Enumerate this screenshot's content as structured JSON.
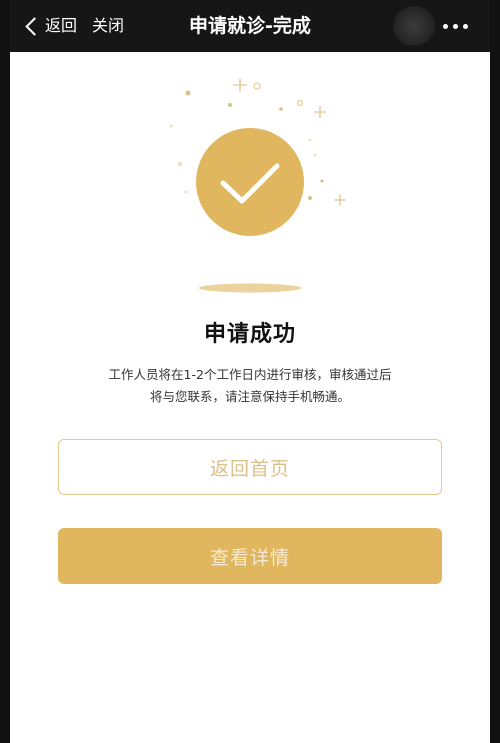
{
  "navbar": {
    "back_label": "返回",
    "close_label": "关闭",
    "title": "申请就诊-完成"
  },
  "result": {
    "title": "申请成功",
    "description_line1": "工作人员将在1-2个工作日内进行审核，审核通过后",
    "description_line2": "将与您联系，请注意保持手机畅通。"
  },
  "buttons": {
    "home_label": "返回首页",
    "detail_label": "查看详情"
  },
  "colors": {
    "accent": "#e0b65f",
    "accent_light": "#e4c88d",
    "navbar_bg": "#161616"
  },
  "icons": {
    "back": "chevron-left-icon",
    "more": "more-dots-icon",
    "success": "check-circle-icon"
  }
}
